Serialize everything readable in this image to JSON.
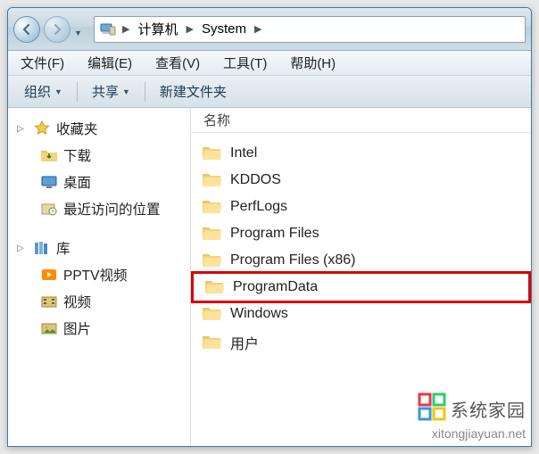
{
  "address": {
    "root": "计算机",
    "segment": "System"
  },
  "menu": {
    "file": "文件(F)",
    "edit": "编辑(E)",
    "view": "查看(V)",
    "tools": "工具(T)",
    "help": "帮助(H)"
  },
  "toolbar": {
    "organize": "组织",
    "share": "共享",
    "newfolder": "新建文件夹"
  },
  "sidebar": {
    "favorites": {
      "label": "收藏夹",
      "items": [
        "下载",
        "桌面",
        "最近访问的位置"
      ]
    },
    "libraries": {
      "label": "库",
      "items": [
        "PPTV视频",
        "视频",
        "图片"
      ]
    }
  },
  "content": {
    "columnName": "名称",
    "items": [
      {
        "name": "Intel",
        "highlight": false
      },
      {
        "name": "KDDOS",
        "highlight": false
      },
      {
        "name": "PerfLogs",
        "highlight": false
      },
      {
        "name": "Program Files",
        "highlight": false
      },
      {
        "name": "Program Files (x86)",
        "highlight": false
      },
      {
        "name": "ProgramData",
        "highlight": true
      },
      {
        "name": "Windows",
        "highlight": false
      },
      {
        "name": "用户",
        "highlight": false
      }
    ]
  },
  "watermark": {
    "brand": "系统家园",
    "url": "xitongjiayuan.net"
  }
}
